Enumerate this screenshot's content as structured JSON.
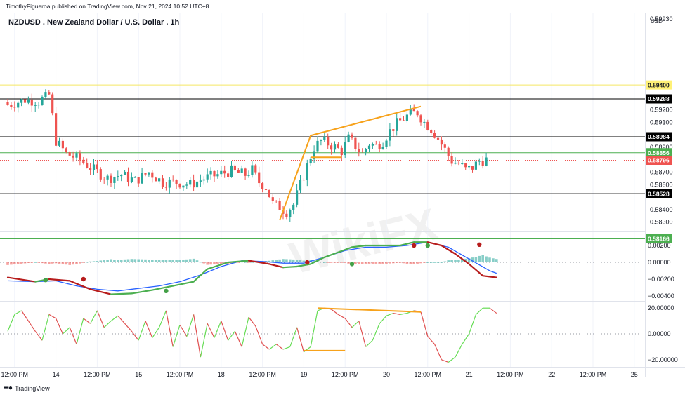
{
  "header": {
    "publisher": "TimothyFigueroa published on TradingView.com, Nov 21, 2024 10:52 UTC+8",
    "title": "NZDUSD . New Zealand Dollar / U.S. Dollar . 1h",
    "currency": "USD",
    "brand": "TradingView"
  },
  "watermark": "WikiFX",
  "colors": {
    "up": "#26a69a",
    "down": "#ef5350",
    "trendline": "#f7a21b",
    "yellow_level": "#f5e663",
    "black_level": "#000000",
    "green_level": "#4caf50",
    "price_line": "#ef5350",
    "macd_signal": "#4caf50",
    "macd_signal_down": "#b71c1c",
    "macd_line": "#2962ff",
    "osc_up": "#66dd55",
    "osc_down": "#e05050"
  },
  "chart_data": [
    {
      "type": "candlestick",
      "title": "NZDUSD . New Zealand Dollar / U.S. Dollar . 1h",
      "ylim": [
        0.58236,
        0.5998
      ],
      "y_ticks": [
        0.5993,
        0.592,
        0.591,
        0.589,
        0.587,
        0.586,
        0.584,
        0.583
      ],
      "y_tick_labels": [
        "0.59930",
        "0.59200",
        "0.59100",
        "0.58900",
        "0.58700",
        "0.58600",
        "0.58400",
        "0.58300"
      ],
      "horizontal_levels": [
        {
          "value": 0.594,
          "label": "0.59400",
          "color": "yellow"
        },
        {
          "value": 0.59288,
          "label": "0.59288",
          "color": "black"
        },
        {
          "value": 0.58984,
          "label": "0.58984",
          "color": "black"
        },
        {
          "value": 0.58856,
          "label": "0.58856",
          "color": "green"
        },
        {
          "value": 0.58796,
          "label": "0.58796",
          "color": "red"
        },
        {
          "value": 0.58528,
          "label": "0.58528",
          "color": "black"
        },
        {
          "value": 0.58166,
          "label": "0.58166",
          "color": "green"
        }
      ],
      "candle_count": 140,
      "close_path": [
        [
          0,
          0.5924
        ],
        [
          5,
          0.5928
        ],
        [
          9,
          0.5927
        ],
        [
          11,
          0.593
        ],
        [
          12,
          0.5932
        ],
        [
          13,
          0.5915
        ],
        [
          14,
          0.5895
        ],
        [
          17,
          0.5885
        ],
        [
          21,
          0.588
        ],
        [
          25,
          0.5872
        ],
        [
          29,
          0.5865
        ],
        [
          33,
          0.5868
        ],
        [
          37,
          0.5863
        ],
        [
          41,
          0.587
        ],
        [
          45,
          0.5862
        ],
        [
          49,
          0.5862
        ],
        [
          53,
          0.586
        ],
        [
          57,
          0.5865
        ],
        [
          61,
          0.5868
        ],
        [
          65,
          0.5871
        ],
        [
          69,
          0.5868
        ],
        [
          71,
          0.5872
        ],
        [
          73,
          0.5862
        ],
        [
          75,
          0.5858
        ],
        [
          77,
          0.5845
        ],
        [
          79,
          0.5842
        ],
        [
          81,
          0.5838
        ],
        [
          83,
          0.5844
        ],
        [
          85,
          0.586
        ],
        [
          87,
          0.5875
        ],
        [
          89,
          0.589
        ],
        [
          91,
          0.5895
        ],
        [
          93,
          0.5893
        ],
        [
          95,
          0.589
        ],
        [
          97,
          0.5887
        ],
        [
          99,
          0.5897
        ],
        [
          101,
          0.5891
        ],
        [
          103,
          0.5885
        ],
        [
          105,
          0.5893
        ],
        [
          107,
          0.5891
        ],
        [
          109,
          0.5895
        ],
        [
          111,
          0.5903
        ],
        [
          113,
          0.5909
        ],
        [
          115,
          0.5913
        ],
        [
          117,
          0.5917
        ],
        [
          119,
          0.5918
        ],
        [
          121,
          0.591
        ],
        [
          123,
          0.5905
        ],
        [
          125,
          0.5897
        ],
        [
          127,
          0.5888
        ],
        [
          129,
          0.5879
        ],
        [
          131,
          0.5877
        ],
        [
          133,
          0.5872
        ],
        [
          135,
          0.5874
        ],
        [
          137,
          0.5879
        ],
        [
          139,
          0.588
        ]
      ],
      "trendlines": [
        {
          "from": [
            79,
            0.58315
          ],
          "to": [
            88,
            0.58994
          ]
        },
        {
          "from": [
            88,
            0.58994
          ],
          "to": [
            120,
            0.59228
          ]
        },
        {
          "from": [
            88,
            0.5882
          ],
          "to": [
            97,
            0.5882
          ]
        }
      ]
    },
    {
      "type": "line",
      "name": "MACD",
      "ylim": [
        -0.0045,
        0.0035
      ],
      "y_ticks": [
        0.002,
        0.0,
        -0.002,
        -0.004
      ],
      "y_tick_labels": [
        "0.00200",
        "0.00000",
        "−0.00200",
        "−0.00400"
      ],
      "signal_path": [
        [
          0,
          -0.0018
        ],
        [
          8,
          -0.0023
        ],
        [
          12,
          -0.002
        ],
        [
          18,
          -0.0022
        ],
        [
          24,
          -0.0032
        ],
        [
          30,
          -0.0038
        ],
        [
          36,
          -0.0037
        ],
        [
          42,
          -0.0033
        ],
        [
          48,
          -0.0028
        ],
        [
          54,
          -0.0023
        ],
        [
          58,
          -0.0008
        ],
        [
          64,
          0.0
        ],
        [
          70,
          0.0002
        ],
        [
          76,
          -0.0002
        ],
        [
          80,
          -0.0006
        ],
        [
          84,
          -0.0005
        ],
        [
          88,
          -0.0002
        ],
        [
          92,
          0.0006
        ],
        [
          96,
          0.0012
        ],
        [
          100,
          0.0018
        ],
        [
          104,
          0.002
        ],
        [
          108,
          0.002
        ],
        [
          114,
          0.002
        ],
        [
          118,
          0.0024
        ],
        [
          122,
          0.0024
        ],
        [
          126,
          0.002
        ],
        [
          130,
          0.001
        ],
        [
          134,
          -0.0002
        ],
        [
          138,
          -0.0016
        ],
        [
          142,
          -0.0018
        ]
      ],
      "macd_path": [
        [
          0,
          -0.0022
        ],
        [
          8,
          -0.0023
        ],
        [
          14,
          -0.0022
        ],
        [
          20,
          -0.0028
        ],
        [
          26,
          -0.0032
        ],
        [
          32,
          -0.0034
        ],
        [
          38,
          -0.0031
        ],
        [
          44,
          -0.0028
        ],
        [
          50,
          -0.0023
        ],
        [
          56,
          -0.0015
        ],
        [
          62,
          -0.0005
        ],
        [
          68,
          0.0002
        ],
        [
          74,
          0.0001
        ],
        [
          80,
          -0.0001
        ],
        [
          86,
          -0.0001
        ],
        [
          92,
          0.0006
        ],
        [
          98,
          0.0014
        ],
        [
          104,
          0.0018
        ],
        [
          110,
          0.0018
        ],
        [
          116,
          0.002
        ],
        [
          122,
          0.0024
        ],
        [
          128,
          0.0018
        ],
        [
          134,
          0.0004
        ],
        [
          140,
          -0.001
        ],
        [
          142,
          -0.0013
        ]
      ],
      "cross_markers": [
        {
          "x": 11,
          "y": -0.0021,
          "color": "green"
        },
        {
          "x": 22,
          "y": -0.002,
          "color": "red"
        },
        {
          "x": 46,
          "y": -0.0034,
          "color": "green"
        },
        {
          "x": 87,
          "y": 0.0,
          "color": "red"
        },
        {
          "x": 100,
          "y": -0.0002,
          "color": "green"
        },
        {
          "x": 118,
          "y": 0.002,
          "color": "red"
        },
        {
          "x": 122,
          "y": 0.002,
          "color": "green"
        },
        {
          "x": 137,
          "y": 0.0021,
          "color": "red"
        }
      ]
    },
    {
      "type": "line",
      "name": "Oscillator",
      "ylim": [
        -25,
        25
      ],
      "y_ticks": [
        20,
        0,
        -20
      ],
      "y_tick_labels": [
        "20.00000",
        "0.00000",
        "−20.00000"
      ],
      "path": [
        [
          0,
          2
        ],
        [
          2,
          15
        ],
        [
          4,
          18
        ],
        [
          6,
          10
        ],
        [
          8,
          2
        ],
        [
          10,
          -5
        ],
        [
          12,
          15
        ],
        [
          14,
          12
        ],
        [
          16,
          0
        ],
        [
          18,
          5
        ],
        [
          20,
          -8
        ],
        [
          22,
          12
        ],
        [
          24,
          8
        ],
        [
          26,
          18
        ],
        [
          28,
          5
        ],
        [
          30,
          10
        ],
        [
          32,
          14
        ],
        [
          34,
          8
        ],
        [
          36,
          2
        ],
        [
          38,
          -5
        ],
        [
          40,
          10
        ],
        [
          42,
          -3
        ],
        [
          44,
          5
        ],
        [
          46,
          18
        ],
        [
          48,
          -10
        ],
        [
          50,
          7
        ],
        [
          52,
          -2
        ],
        [
          54,
          15
        ],
        [
          56,
          -18
        ],
        [
          58,
          8
        ],
        [
          60,
          -3
        ],
        [
          62,
          10
        ],
        [
          64,
          -5
        ],
        [
          66,
          2
        ],
        [
          68,
          -10
        ],
        [
          70,
          13
        ],
        [
          72,
          6
        ],
        [
          74,
          -8
        ],
        [
          76,
          -12
        ],
        [
          78,
          -8
        ],
        [
          80,
          -12
        ],
        [
          82,
          -10
        ],
        [
          84,
          5
        ],
        [
          86,
          -14
        ],
        [
          88,
          -10
        ],
        [
          90,
          18
        ],
        [
          92,
          20
        ],
        [
          94,
          19
        ],
        [
          96,
          15
        ],
        [
          98,
          12
        ],
        [
          100,
          5
        ],
        [
          102,
          10
        ],
        [
          104,
          -10
        ],
        [
          106,
          -5
        ],
        [
          108,
          8
        ],
        [
          110,
          14
        ],
        [
          112,
          16
        ],
        [
          114,
          15
        ],
        [
          116,
          16
        ],
        [
          118,
          18
        ],
        [
          120,
          17
        ],
        [
          122,
          -2
        ],
        [
          124,
          -8
        ],
        [
          126,
          -20
        ],
        [
          128,
          -22
        ],
        [
          130,
          -18
        ],
        [
          132,
          -8
        ],
        [
          134,
          0
        ],
        [
          136,
          15
        ],
        [
          138,
          20
        ],
        [
          140,
          20
        ],
        [
          142,
          16
        ]
      ],
      "trendlines": [
        {
          "from": [
            90,
            20
          ],
          "to": [
            120,
            17
          ]
        },
        {
          "from": [
            86,
            -13
          ],
          "to": [
            98,
            -13
          ]
        }
      ]
    }
  ],
  "time_axis": {
    "ticks": [
      {
        "i": 2,
        "label": "12:00 PM"
      },
      {
        "i": 14,
        "label": "14"
      },
      {
        "i": 26,
        "label": "12:00 PM"
      },
      {
        "i": 38,
        "label": "15"
      },
      {
        "i": 50,
        "label": "12:00 PM"
      },
      {
        "i": 62,
        "label": "18"
      },
      {
        "i": 74,
        "label": "12:00 PM"
      },
      {
        "i": 86,
        "label": "19"
      },
      {
        "i": 98,
        "label": "12:00 PM"
      },
      {
        "i": 110,
        "label": "20"
      },
      {
        "i": 122,
        "label": "12:00 PM"
      },
      {
        "i": 134,
        "label": "21"
      },
      {
        "i": 146,
        "label": "12:00 PM"
      },
      {
        "i": 158,
        "label": "22"
      },
      {
        "i": 170,
        "label": "12:00 PM"
      },
      {
        "i": 182,
        "label": "25"
      }
    ]
  }
}
